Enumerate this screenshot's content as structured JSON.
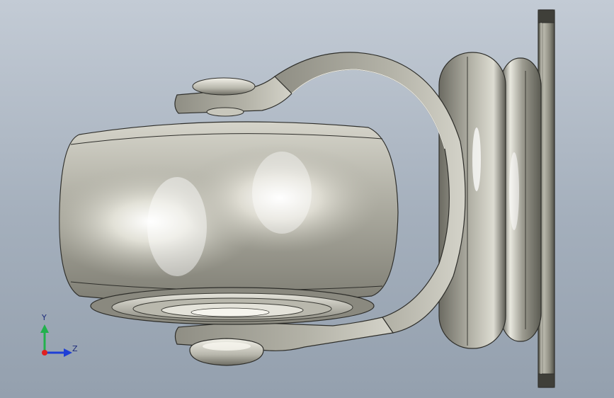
{
  "viewport": {
    "background_top": "#c3cbd5",
    "background_bottom": "#94a0ae",
    "model": "caster-wheel-assembly"
  },
  "triad": {
    "y_label": "Y",
    "z_label": "Z",
    "y_color": "#22b14c",
    "z_color": "#1f3fd6",
    "x_color": "#e02020"
  }
}
